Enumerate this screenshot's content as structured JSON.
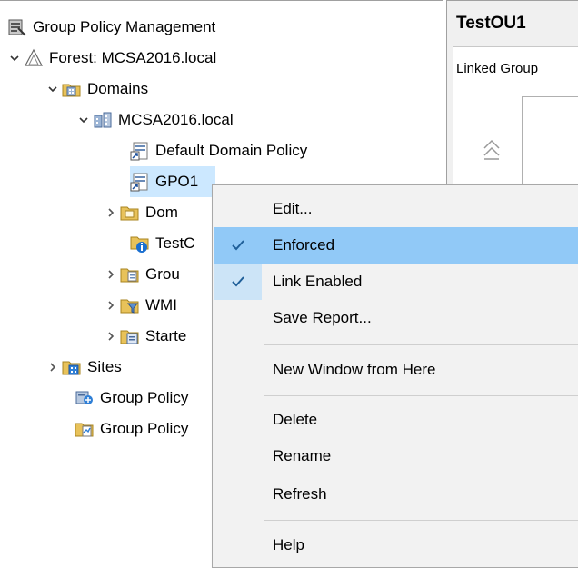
{
  "tree": {
    "root": "Group Policy Management",
    "forest": "Forest: MCSA2016.local",
    "domains": "Domains",
    "domain": "MCSA2016.local",
    "default_domain_policy": "Default Domain Policy",
    "gpo1": "GPO1",
    "dom_partial": "Dom",
    "testou_partial": "TestC",
    "group_partial": "Grou",
    "wmi_partial": "WMI",
    "starter_partial": "Starte",
    "sites": "Sites",
    "gp_modeling": "Group Policy",
    "gp_results": "Group Policy"
  },
  "right_pane": {
    "title": "TestOU1",
    "tab": "Linked Group"
  },
  "context_menu": {
    "edit": "Edit...",
    "enforced": "Enforced",
    "link_enabled": "Link Enabled",
    "save_report": "Save Report...",
    "new_window": "New Window from Here",
    "delete": "Delete",
    "rename": "Rename",
    "refresh": "Refresh",
    "help": "Help",
    "enforced_checked": true,
    "link_enabled_checked": true
  },
  "colors": {
    "menu_highlight": "#91c9f7",
    "selection": "#cce8ff",
    "menu_bg": "#f2f2f2",
    "check": "#1f5f99"
  }
}
